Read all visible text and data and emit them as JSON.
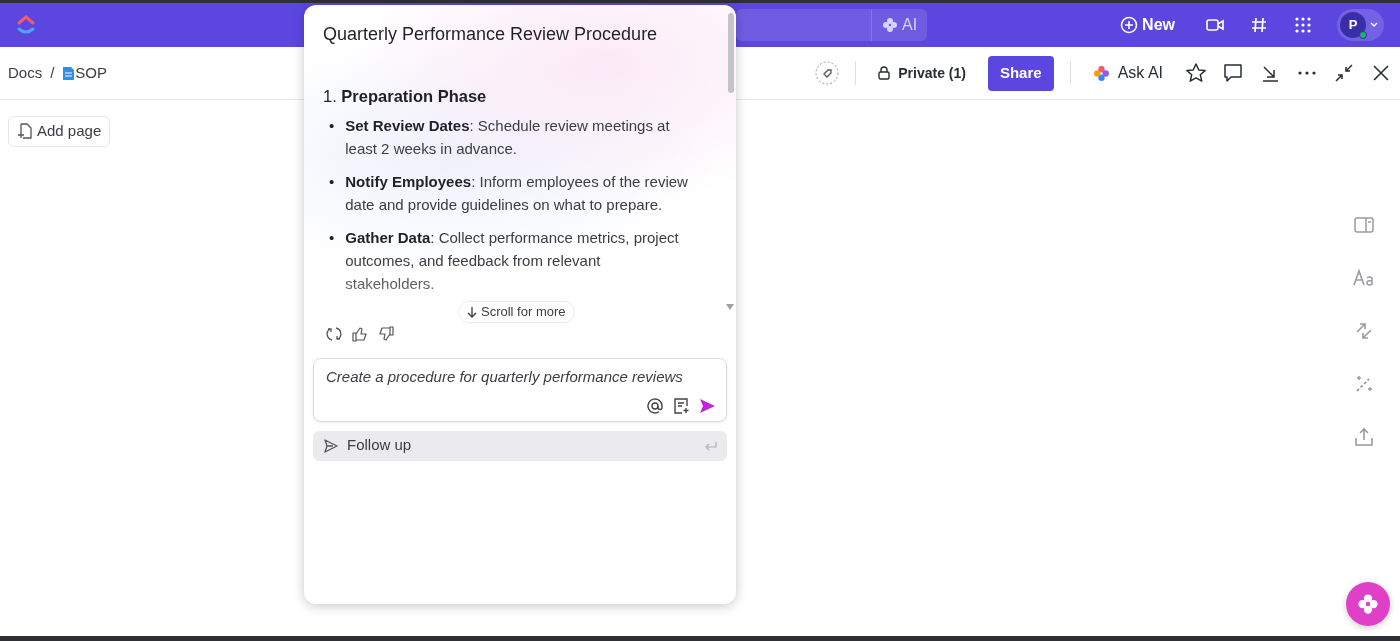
{
  "topbar": {
    "ai_button": "AI",
    "new_button": "New",
    "avatar": {
      "initial": "P",
      "online": true
    }
  },
  "breadcrumb": [
    "Docs",
    "SOP"
  ],
  "breadcrumb_separator": "/",
  "toolbar": {
    "privacy": "Private (1)",
    "share": "Share",
    "ask_ai": "Ask AI"
  },
  "add_page": "Add page",
  "ai_panel": {
    "title": "Quarterly Performance Review Procedure",
    "section": "1. **Preparation Phase**",
    "items": [
      {
        "marker": "•",
        "text": "**Set Review Dates**: Schedule review meetings at least 2 weeks in advance."
      },
      {
        "marker": "•",
        "text": "**Notify Employees**: Inform employees of the review date and provide guidelines on what to prepare."
      },
      {
        "marker": "•",
        "text": "**Gather Data**: Collect performance metrics, project outcomes, and feedback from relevant stakeholders."
      }
    ],
    "scroll_hint": "Scroll for more",
    "prompt": "Create a procedure for quarterly performance reviews",
    "follow_up": "Follow up"
  }
}
